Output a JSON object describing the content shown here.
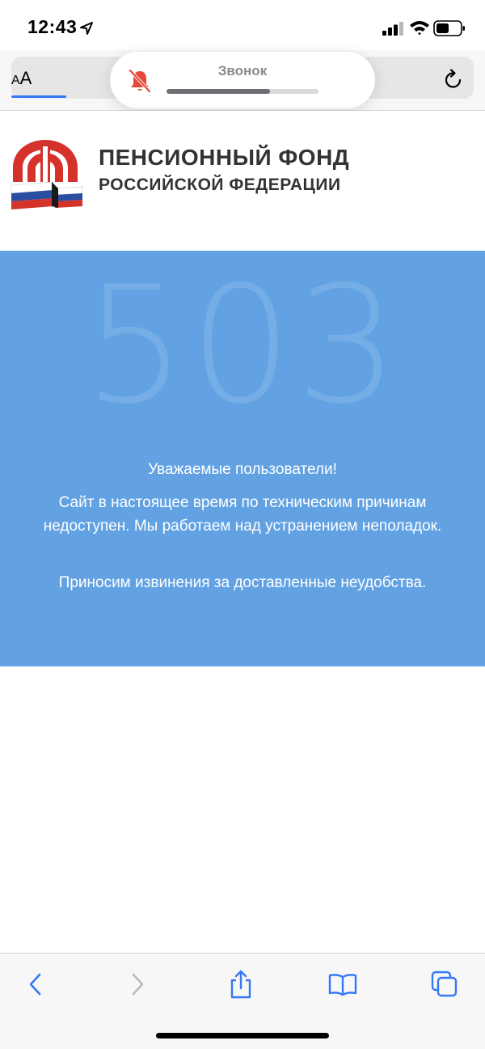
{
  "status_bar": {
    "time": "12:43",
    "icons": [
      "location-arrow-icon",
      "cellular-signal-icon",
      "wifi-icon",
      "battery-icon"
    ]
  },
  "browser": {
    "text_size_label_small": "A",
    "text_size_label_large": "A",
    "icons": [
      "reload-icon"
    ]
  },
  "ringer_hud": {
    "label": "Звонок",
    "volume_fraction": 0.68,
    "icons": [
      "bell-muted-icon"
    ]
  },
  "site_header": {
    "logo_line1": "ПЕНСИОННЫЙ ФОНД",
    "logo_line2": "РОССИЙСКОЙ ФЕДЕРАЦИИ"
  },
  "error": {
    "code": "503",
    "greeting": "Уважаемые пользователи!",
    "body": "Сайт в настоящее время по техническим причинам недоступен. Мы работаем над устранением неполадок.",
    "apology": "Приносим извинения за доставленные неудобства."
  },
  "toolbar": {
    "icons": [
      "back-chevron-icon",
      "forward-chevron-icon",
      "share-icon",
      "bookmarks-icon",
      "tabs-icon"
    ]
  },
  "colors": {
    "accent": "#3478f6",
    "error_background": "#62a2e3",
    "logo_red": "#d5322c",
    "logo_blue": "#2b4fa0"
  }
}
